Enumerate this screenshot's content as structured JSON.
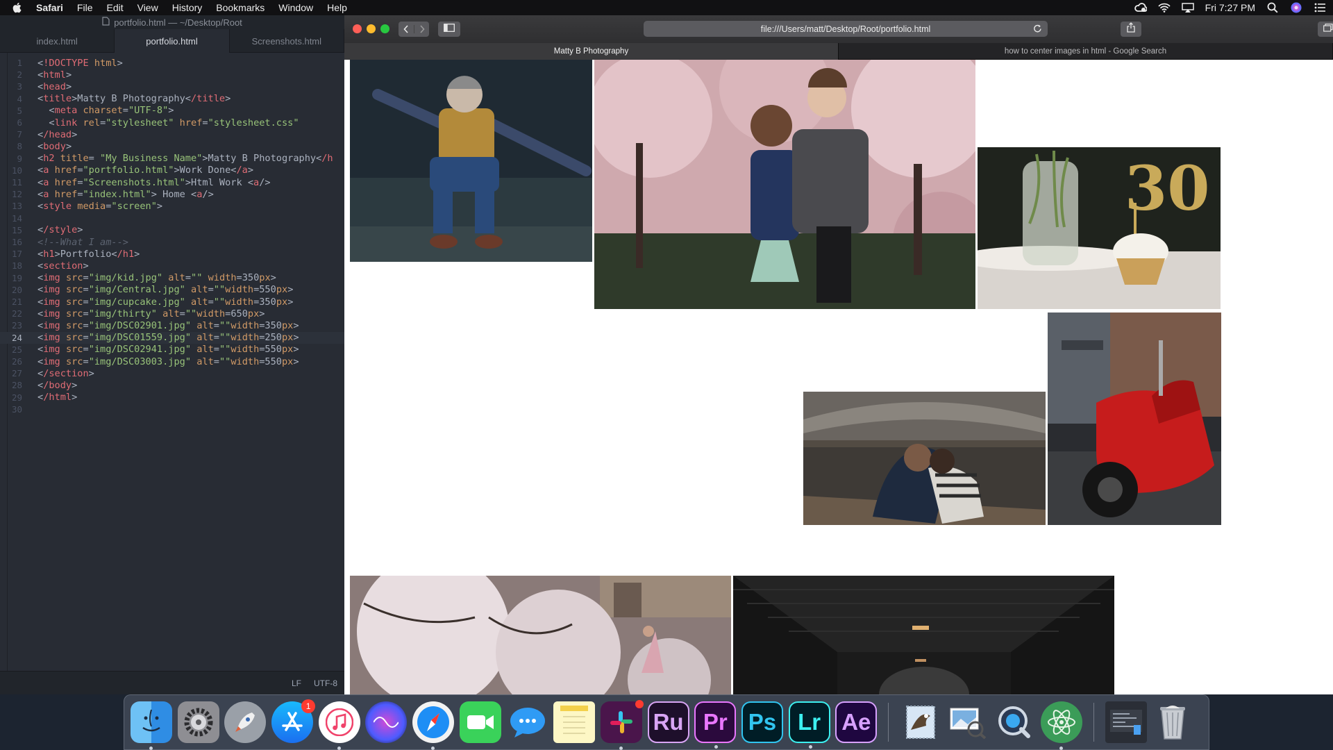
{
  "menubar": {
    "app_name": "Safari",
    "items": [
      "File",
      "Edit",
      "View",
      "History",
      "Bookmarks",
      "Window",
      "Help"
    ],
    "clock": "Fri 7:27 PM",
    "status_icons": [
      "creative-cloud-icon",
      "wifi-icon",
      "airplay-icon",
      "spotlight-icon",
      "siri-icon",
      "notification-center-icon"
    ]
  },
  "editor": {
    "window_title": "portfolio.html — ~/Desktop/Root",
    "tabs": [
      {
        "label": "index.html",
        "active": false
      },
      {
        "label": "portfolio.html",
        "active": true
      },
      {
        "label": "Screenshots.html",
        "active": false
      }
    ],
    "current_line": 24,
    "lines": [
      "<!DOCTYPE html>",
      "<html>",
      "<head>",
      "<title>Matty B Photography</title>",
      "  <meta charset=\"UTF-8\">",
      "  <link rel=\"stylesheet\" href=\"stylesheet.css\"",
      "</head>",
      "<body>",
      "<h2 title= \"My Business Name\">Matty B Photography</h",
      "<a href=\"portfolio.html\">Work Done</a>",
      "<a href=\"Screenshots.html\">Html Work <a/>",
      "<a href=\"index.html\"> Home <a/>",
      "<style media=\"screen\">",
      "",
      "</style>",
      "<!--What I am-->",
      "<h1>Portfolio</h1>",
      "<section>",
      "<img src=\"img/kid.jpg\" alt=\"\" width=350px>",
      "<img src=\"img/Central.jpg\" alt=\"\"width=550px>",
      "<img src=\"img/cupcake.jpg\" alt=\"\"width=350px>",
      "<img src=\"img/thirty\" alt=\"\"width=650px>",
      "<img src=\"img/DSC02901.jpg\" alt=\"\"width=350px>",
      "<img src=\"img/DSC01559.jpg\" alt=\"\"width=250px>",
      "<img src=\"img/DSC02941.jpg\" alt=\"\"width=550px>",
      "<img src=\"img/DSC03003.jpg\" alt=\"\"width=550px>",
      "</section>",
      "</body>",
      "</html>",
      ""
    ],
    "status": {
      "line_ending": "LF",
      "encoding": "UTF-8"
    }
  },
  "safari": {
    "url": "file:///Users/matt/Desktop/Root/portfolio.html",
    "tabs": [
      {
        "label": "Matty B Photography",
        "active": true
      },
      {
        "label": "how to center images in html - Google Search",
        "active": false
      }
    ],
    "photos": [
      "kid",
      "Central",
      "cupcake",
      "DSC02901",
      "DSC01559",
      "DSC02941",
      "DSC03003"
    ],
    "cake_topper": "30"
  },
  "dock": {
    "apps": [
      {
        "name": "Finder",
        "running": true
      },
      {
        "name": "System Preferences",
        "running": false
      },
      {
        "name": "Launchpad",
        "running": false
      },
      {
        "name": "App Store",
        "running": false,
        "badge": "1"
      },
      {
        "name": "iTunes",
        "running": true
      },
      {
        "name": "Siri",
        "running": false
      },
      {
        "name": "Safari",
        "running": true
      },
      {
        "name": "FaceTime",
        "running": false
      },
      {
        "name": "Messages",
        "running": false
      },
      {
        "name": "Notes",
        "running": false
      },
      {
        "name": "Slack",
        "running": true
      },
      {
        "name": "Ru",
        "running": false
      },
      {
        "name": "Pr",
        "running": true
      },
      {
        "name": "Ps",
        "running": false
      },
      {
        "name": "Lr",
        "running": true
      },
      {
        "name": "Ae",
        "running": false
      },
      {
        "name": "Mail",
        "running": false
      },
      {
        "name": "Preview",
        "running": false
      },
      {
        "name": "QuickTime Player",
        "running": false
      },
      {
        "name": "Atom",
        "running": true
      },
      {
        "name": "Downloads",
        "running": false
      },
      {
        "name": "Trash",
        "running": false
      }
    ]
  },
  "colors": {
    "editor_bg": "#282c34",
    "safari_chrome": "#3a3a3c",
    "tag": "#e06c75",
    "attr": "#d19a66",
    "string": "#98c379",
    "comment": "#5c6370"
  }
}
